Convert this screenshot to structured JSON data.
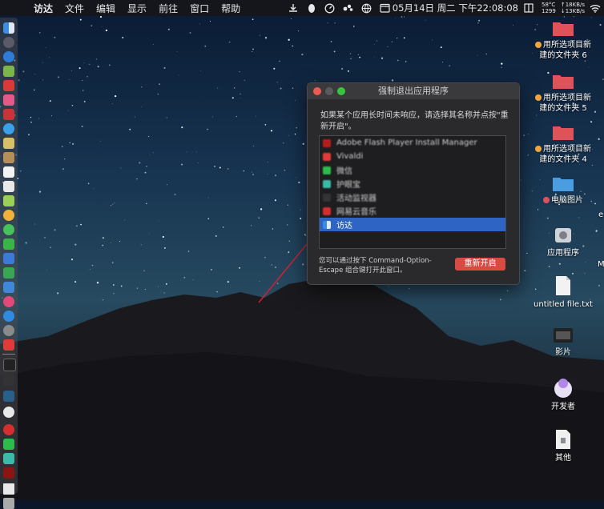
{
  "menubar": {
    "app_name": "访达",
    "menus": [
      "文件",
      "编辑",
      "显示",
      "前往",
      "窗口",
      "帮助"
    ],
    "date_time": "05月14日 周二 下午22:08:08",
    "temperature": "58°C",
    "temp_sub": "1299",
    "net_up": "↑18KB/s",
    "net_down": "↓13KB/s"
  },
  "dialog": {
    "title": "强制退出应用程序",
    "prompt": "如果某个应用长时间未响应，请选择其名称并点按\"重新开启\"。",
    "apps": [
      {
        "name": "Adobe Flash Player Install Manager",
        "color": "#b81d1d"
      },
      {
        "name": "Vivaldi",
        "color": "#e03a3a"
      },
      {
        "name": "微信",
        "color": "#2dbb4e"
      },
      {
        "name": "护眼宝",
        "color": "#3bb9a9"
      },
      {
        "name": "活动监视器",
        "color": "#333333"
      },
      {
        "name": "网易云音乐",
        "color": "#d32f2f"
      },
      {
        "name": "访达",
        "color": "#3a78d6"
      }
    ],
    "selected_index": 6,
    "hint": "您可以通过按下 Command-Option-Escape 组合键打开此窗口。",
    "relaunch_label": "重新开启"
  },
  "desktop": {
    "items": [
      {
        "label": "用所选项目新建的文件夹 6",
        "icon": "red-folder-icon",
        "color": "#e0525a"
      },
      {
        "label": "用所选项目新建的文件夹 5",
        "icon": "red-folder-icon",
        "color": "#e0525a"
      },
      {
        "label": "用所选项目新建的文件夹 4",
        "icon": "red-folder-icon",
        "color": "#e0525a"
      },
      {
        "label": "电脑图片",
        "icon": "blue-folder-icon",
        "color": "#4a9de0"
      },
      {
        "label": "应用程序",
        "icon": "applications-disk-icon",
        "color": "#cfd3d8"
      },
      {
        "label": "untitled file.txt",
        "icon": "text-file-icon",
        "color": "#f2f2f2"
      },
      {
        "label": "影片",
        "icon": "movie-icon",
        "color": "#222222"
      },
      {
        "label": "开发者",
        "icon": "developer-icon",
        "color": "#e8e0f5"
      },
      {
        "label": "其他",
        "icon": "archive-file-icon",
        "color": "#efefef"
      }
    ],
    "partial_labels": [
      "e",
      "M"
    ]
  },
  "colors": {
    "selection": "#2e65c4",
    "relaunch": "#d94a43"
  }
}
